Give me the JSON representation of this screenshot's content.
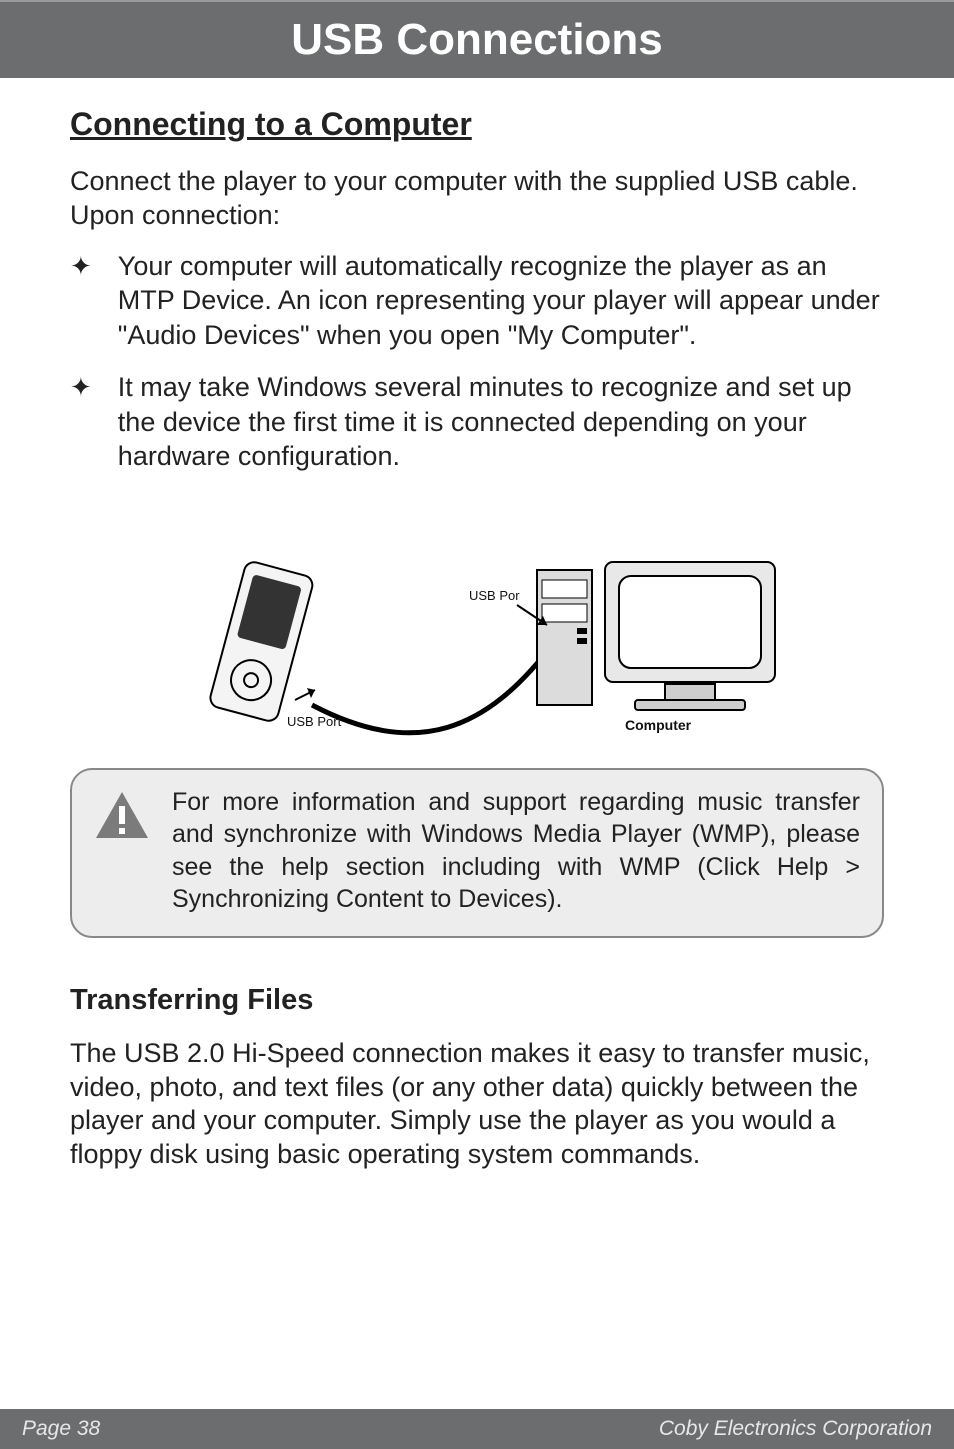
{
  "title_bar": "USB Connections",
  "section_heading": "Connecting to a Computer",
  "intro_para": "Connect the player to your computer with the supplied USB cable.  Upon connection:",
  "bullets": [
    "Your computer will automatically recognize the player as an MTP Device.  An icon representing your player will appear under \"Audio Devices\" when you open \"My Computer\".",
    "It may take Windows several minutes to recognize and set up the device the first time it is connected depending on your hardware configuration."
  ],
  "diagram": {
    "label_usb_port_player": "USB Port",
    "label_usb_port_computer": "USB Por",
    "label_computer": "Computer"
  },
  "note_text": "For more information and support regarding music transfer and synchronize with Windows Media Player (WMP), please see the help section including with WMP (Click Help > Synchronizing Content to Devices).",
  "subsection_heading": "Transferring Files",
  "trans_para": "The USB 2.0 Hi-Speed connection makes it easy to transfer music, video, photo, and text files (or any other data) quickly between the player and your computer. Simply use the player as you would a floppy disk using basic operating system commands.",
  "footer_left": "Page 38",
  "footer_right": "Coby Electronics Corporation",
  "icons": {
    "bullet_name": "sparkle-icon",
    "warning_name": "warning-icon"
  }
}
